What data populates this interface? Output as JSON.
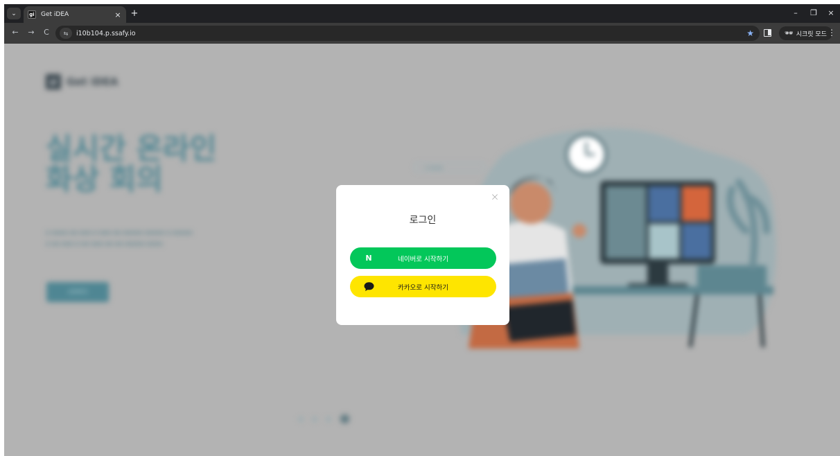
{
  "browser": {
    "tab": {
      "title": "Get iDEA",
      "favicon_text": "gi",
      "close_glyph": "×"
    },
    "new_tab_glyph": "+",
    "window_controls": {
      "minimize": "–",
      "restore": "❐",
      "close": "×"
    },
    "nav": {
      "back": "←",
      "forward": "→",
      "reload": "C"
    },
    "address": {
      "url": "i10b104.p.ssafy.io",
      "site_info_glyph": "⇆"
    },
    "bookmark_glyph": "★",
    "incognito": {
      "glyph": "🕶",
      "label": "시크릿 모드"
    },
    "menu_glyph": "⋮",
    "tab_menu_glyph": "⌄"
  },
  "page": {
    "logo": {
      "mark": "gi",
      "name": "Get iDEA"
    },
    "hero": {
      "title_line1": "실시간 온라인",
      "title_line2": "화상 회의"
    },
    "start_button": "시작하기"
  },
  "modal": {
    "close_glyph": "×",
    "title": "로그인",
    "naver": {
      "icon": "N",
      "label": "네이버로 시작하기",
      "color": "#03c75a"
    },
    "kakao": {
      "icon": "speech-bubble-icon",
      "label": "카카오로 시작하기",
      "color": "#fee500"
    }
  }
}
